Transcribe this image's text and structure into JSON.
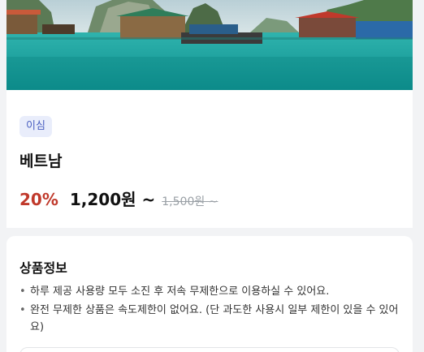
{
  "hero": {
    "image": "halong-bay-floating-village-photo"
  },
  "product": {
    "tag": "이심",
    "title": "베트남",
    "discount": "20%",
    "price": "1,200원 ~",
    "original_price": "1,500원 ~"
  },
  "info": {
    "title": "상품정보",
    "items": [
      "하루 제공 사용량 모두 소진 후 저속 무제한으로 이용하실 수 있어요.",
      "완전 무제한 상품은 속도제한이 없어요. (단 과도한 사용시 일부 제한이 있을 수 있어요)"
    ]
  },
  "colors": {
    "discount": "#c0392b",
    "tag_bg": "#e9edfb",
    "tag_text": "#4a5fc1"
  }
}
